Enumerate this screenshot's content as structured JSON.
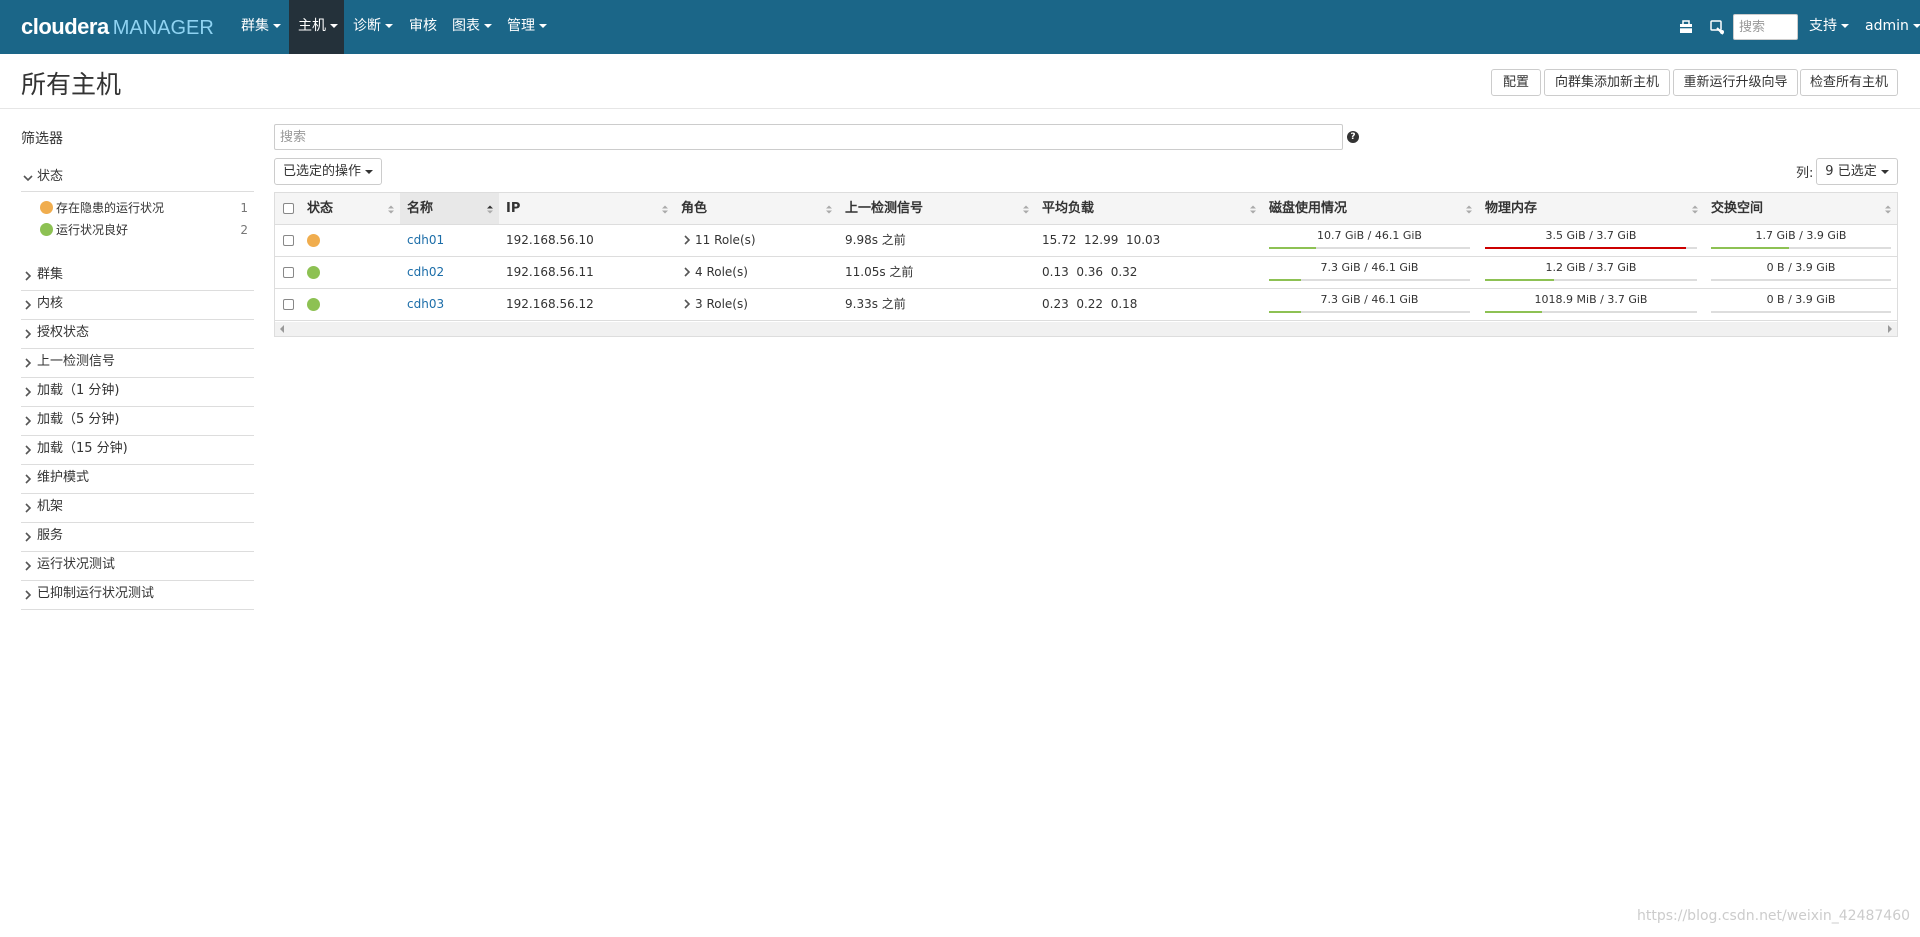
{
  "nav": {
    "brand_main": "cloudera",
    "brand_sub": "MANAGER",
    "items": [
      {
        "label": "群集"
      },
      {
        "label": "主机"
      },
      {
        "label": "诊断"
      },
      {
        "label": "审核"
      },
      {
        "label": "图表"
      },
      {
        "label": "管理"
      }
    ],
    "search_placeholder": "搜索",
    "support_label": "支持",
    "user_label": "admin",
    "icons": [
      "parcel-icon",
      "running-commands-icon"
    ]
  },
  "page": {
    "title": "所有主机",
    "buttons": {
      "config": "配置",
      "add_hosts": "向群集添加新主机",
      "rerun_upgrade": "重新运行升级向导",
      "inspect_all": "检查所有主机"
    }
  },
  "filters": {
    "title": "筛选器",
    "status_group": "状态",
    "status_items": [
      {
        "label": "存在隐患的运行状况",
        "count": "1",
        "color": "#f0ad4e"
      },
      {
        "label": "运行状况良好",
        "count": "2",
        "color": "#8dc153"
      }
    ],
    "groups": [
      "群集",
      "内核",
      "授权状态",
      "上一检测信号",
      "加载（1 分钟)",
      "加载（5 分钟)",
      "加载（15 分钟)",
      "维护模式",
      "机架",
      "服务",
      "运行状况测试",
      "已抑制运行状况测试"
    ]
  },
  "search": {
    "placeholder": "搜索",
    "help": "?"
  },
  "actions": {
    "selected_ops": "已选定的操作",
    "columns_label": "列:",
    "columns_selected": "9 已选定"
  },
  "table": {
    "headers": {
      "status": "状态",
      "name": "名称",
      "ip": "IP",
      "roles": "角色",
      "heartbeat": "上一检测信号",
      "load": "平均负载",
      "disk": "磁盘使用情况",
      "memory": "物理内存",
      "swap": "交换空间"
    },
    "rows": [
      {
        "status_color": "#f0ad4e",
        "name": "cdh01",
        "ip": "192.168.56.10",
        "roles": "11 Role(s)",
        "heartbeat": "9.98s 之前",
        "load": "15.72  12.99  10.03",
        "disk": {
          "label": "10.7 GiB / 46.1 GiB",
          "fraction": 0.232,
          "color": "#8dc153"
        },
        "memory": {
          "label": "3.5 GiB / 3.7 GiB",
          "fraction": 0.946,
          "color": "#cc0000"
        },
        "swap": {
          "label": "1.7 GiB / 3.9 GiB",
          "fraction": 0.436,
          "color": "#8dc153"
        }
      },
      {
        "status_color": "#8dc153",
        "name": "cdh02",
        "ip": "192.168.56.11",
        "roles": "4 Role(s)",
        "heartbeat": "11.05s 之前",
        "load": "0.13  0.36  0.32",
        "disk": {
          "label": "7.3 GiB / 46.1 GiB",
          "fraction": 0.158,
          "color": "#8dc153"
        },
        "memory": {
          "label": "1.2 GiB / 3.7 GiB",
          "fraction": 0.324,
          "color": "#8dc153"
        },
        "swap": {
          "label": "0 B / 3.9 GiB",
          "fraction": 0,
          "color": "#8dc153"
        }
      },
      {
        "status_color": "#8dc153",
        "name": "cdh03",
        "ip": "192.168.56.12",
        "roles": "3 Role(s)",
        "heartbeat": "9.33s 之前",
        "load": "0.23  0.22  0.18",
        "disk": {
          "label": "7.3 GiB / 46.1 GiB",
          "fraction": 0.158,
          "color": "#8dc153"
        },
        "memory": {
          "label": "1018.9 MiB / 3.7 GiB",
          "fraction": 0.269,
          "color": "#8dc153"
        },
        "swap": {
          "label": "0 B / 3.9 GiB",
          "fraction": 0,
          "color": "#8dc153"
        }
      }
    ]
  },
  "watermark": "https://blog.csdn.net/weixin_42487460"
}
